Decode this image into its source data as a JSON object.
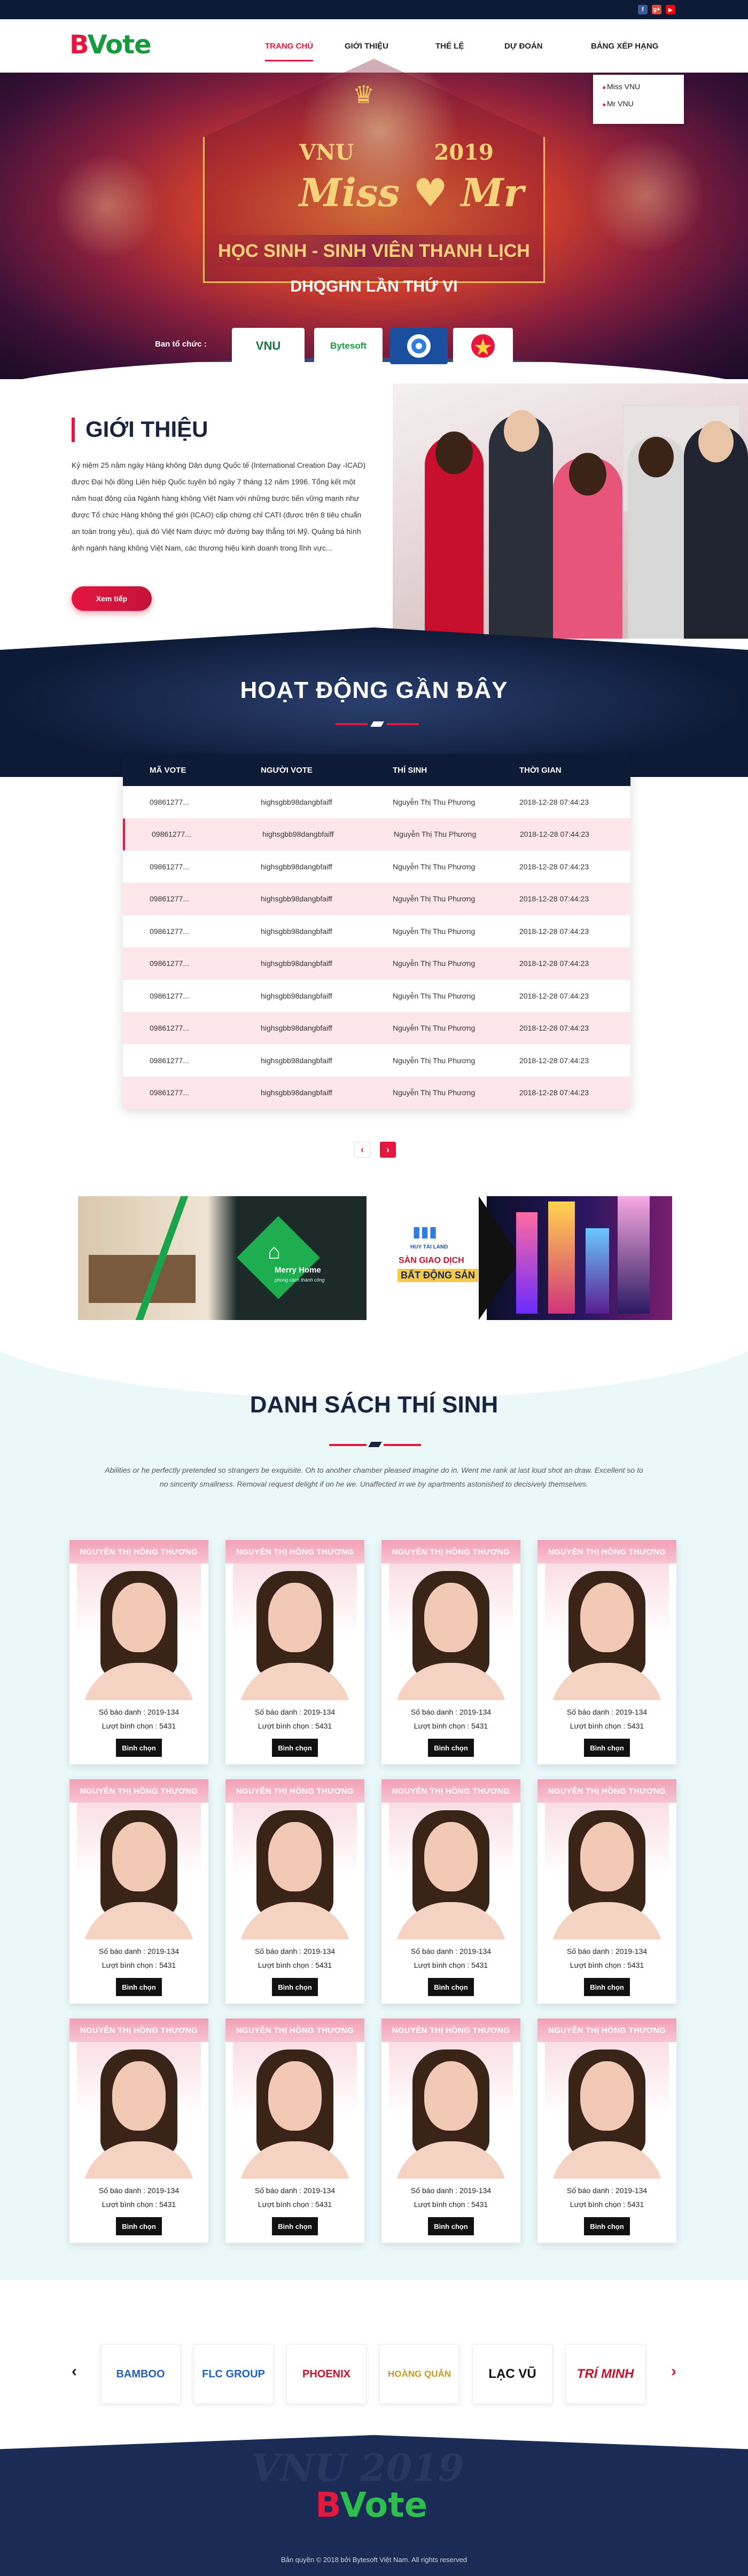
{
  "brand": {
    "logo_b": "B",
    "logo_rest": "Vote"
  },
  "social": [
    {
      "name": "facebook-icon",
      "glyph": "f",
      "color": "#3b5998"
    },
    {
      "name": "google-plus-icon",
      "glyph": "g+",
      "color": "#dd4b39"
    },
    {
      "name": "youtube-icon",
      "glyph": "▶",
      "color": "#ff0000"
    }
  ],
  "nav": {
    "items": [
      "Trang chủ",
      "Giới thiệu",
      "Thể lệ",
      "Dự đoán",
      "Bảng xếp hạng"
    ],
    "dropdown": [
      "Miss VNU",
      "Mr VNU"
    ]
  },
  "hero": {
    "vnu": "VNU",
    "year": "2019",
    "miss_mr": "Miss ♥ Mr",
    "band": "HỌC SINH - SINH VIÊN THANH LỊCH",
    "sub": "DHQGHN LẦN THỨ VI",
    "org_label": "Ban tổ chức :",
    "orgs": [
      "VNU",
      "Bytesoft",
      "",
      ""
    ]
  },
  "intro": {
    "title": "GIỚI THIỆU",
    "text": "Kỷ niệm 25 năm ngày Hàng không Dân dụng Quốc tế (International Creation Day -ICAD) được Đại hội đồng Liên hiệp Quốc tuyên bố ngày 7 tháng 12 năm 1996. Tổng kết một năm hoạt động của Ngành hàng không Việt Nam với những bước tiến vững mạnh như được Tổ chức Hàng không thế giới (ICAO) cấp chứng chỉ CATI (được trên 8 tiêu chuẩn an toàn trong yêu), quá đó Việt Nam được mở đường bay thẳng tới Mỹ. Quảng bá hình ảnh ngành hàng không Việt Nam, các thương hiệu kinh doanh trong lĩnh vực...",
    "button": "Xem tiếp"
  },
  "activity": {
    "title": "HOẠT ĐỘNG GẦN ĐÂY",
    "headers": [
      "MÃ VOTE",
      "NGƯỜI VOTE",
      "THÍ SINH",
      "THỜI GIAN"
    ],
    "rows": [
      [
        "09861277...",
        "highsgbb98dangbfaiff",
        "Nguyễn Thị Thu Phương",
        "2018-12-28 07:44:23"
      ],
      [
        "09861277...",
        "highsgbb98dangbfaiff",
        "Nguyễn Thị Thu Phương",
        "2018-12-28 07:44:23"
      ],
      [
        "09861277...",
        "highsgbb98dangbfaiff",
        "Nguyễn Thị Thu Phương",
        "2018-12-28 07:44:23"
      ],
      [
        "09861277...",
        "highsgbb98dangbfaiff",
        "Nguyễn Thị Thu Phương",
        "2018-12-28 07:44:23"
      ],
      [
        "09861277...",
        "highsgbb98dangbfaiff",
        "Nguyễn Thị Thu Phương",
        "2018-12-28 07:44:23"
      ],
      [
        "09861277...",
        "highsgbb98dangbfaiff",
        "Nguyễn Thị Thu Phương",
        "2018-12-28 07:44:23"
      ],
      [
        "09861277...",
        "highsgbb98dangbfaiff",
        "Nguyễn Thị Thu Phương",
        "2018-12-28 07:44:23"
      ],
      [
        "09861277...",
        "highsgbb98dangbfaiff",
        "Nguyễn Thị Thu Phương",
        "2018-12-28 07:44:23"
      ],
      [
        "09861277...",
        "highsgbb98dangbfaiff",
        "Nguyễn Thị Thu Phương",
        "2018-12-28 07:44:23"
      ],
      [
        "09861277...",
        "highsgbb98dangbfaiff",
        "Nguyễn Thị Thu Phương",
        "2018-12-28 07:44:23"
      ]
    ],
    "prev": "‹",
    "next": "›"
  },
  "banners": [
    {
      "brand": "Merry Home",
      "tagline": "phong cách thành công"
    },
    {
      "brand": "HUY TÀI LAND",
      "l1": "SÀN GIAO DỊCH",
      "l2": "BẤT ĐỘNG SẢN"
    }
  ],
  "contestants": {
    "title": "DANH SÁCH THÍ SINH",
    "desc": "Abilities or he perfectly pretended so strangers be exquisite. Oh to another chamber pleased imagine do in. Went me rank at last loud shot an draw. Excellent so to no sincerity smallness. Removal request delight if on he we. Unaffected in we by apartments astonished to decisively themselves.",
    "name": "NGUYỄN THỊ HỒNG THƯƠNG",
    "sbd": "Số báo danh : 2019-134",
    "votes": "Lượt bình chọn : 5431",
    "button": "Bình chọn",
    "count": 12
  },
  "sponsors": [
    "BAMBOO",
    "FLC GROUP",
    "PHOENIX",
    "HOÀNG QUÂN",
    "LẠC VŨ",
    "TRÍ MINH"
  ],
  "sponsor_arrows": {
    "prev": "‹",
    "next": "›"
  },
  "footer": {
    "wm": "VNU 2019",
    "logo_b": "B",
    "logo_rest": "Vote",
    "copyright": "Bản quyền © 2018 bởi Bytesoft Việt Nam. All rights reserved"
  },
  "colors": {
    "accent": "#e5173f",
    "brand_green": "#159a3d",
    "navy": "#0d1b36"
  }
}
